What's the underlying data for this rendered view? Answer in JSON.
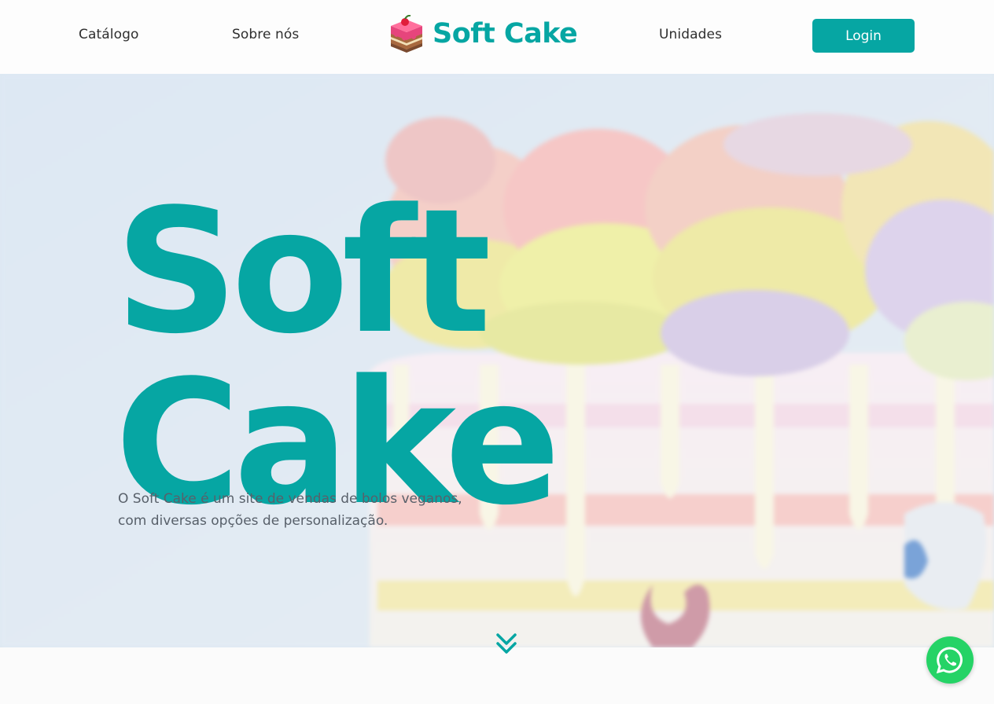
{
  "nav": {
    "links": [
      "Catálogo",
      "Sobre nós",
      "Unidades"
    ],
    "brand_name": "Soft Cake",
    "brand_icon": "cake-icon",
    "login_label": "Login"
  },
  "hero": {
    "title_line1": "Soft",
    "title_line2": "Cake",
    "description_line1": "O Soft Cake é um site de vendas de bolos veganos,",
    "description_line2": "com diversas opções de personalização.",
    "scroll_icon": "double-chevron-down-icon"
  },
  "floating": {
    "whatsapp_icon": "whatsapp-icon"
  },
  "colors": {
    "accent": "#06a6a3",
    "whatsapp": "#25d366",
    "text_dark": "#2e2e2e",
    "text_muted": "#58606a"
  }
}
